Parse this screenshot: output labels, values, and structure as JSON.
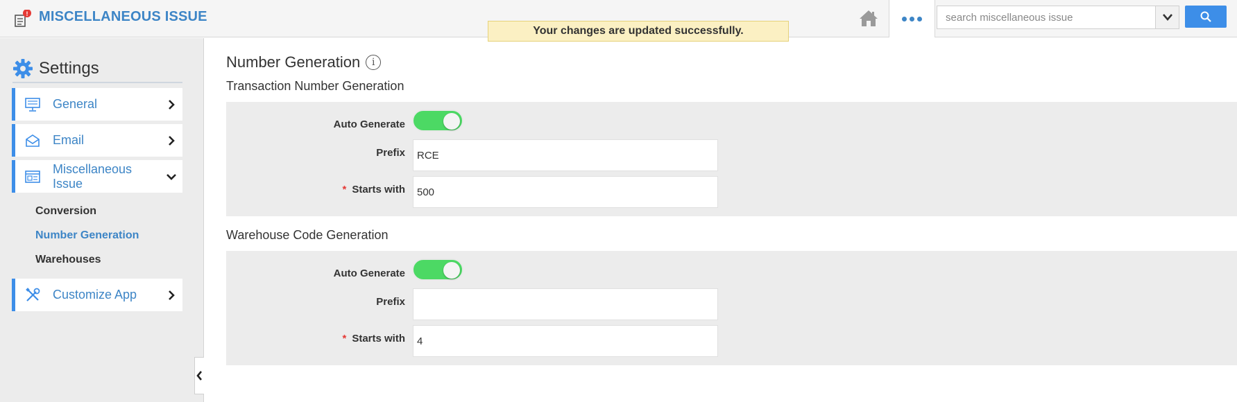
{
  "app": {
    "title": "MISCELLANEOUS ISSUE",
    "notification_count": "!"
  },
  "toast": {
    "message": "Your changes are updated successfully."
  },
  "header": {
    "home_icon": "home-icon",
    "more_icon": "ellipsis-icon",
    "search": {
      "placeholder": "search miscellaneous issue",
      "value": ""
    },
    "search_button_icon": "search-icon"
  },
  "sidebar": {
    "title": "Settings",
    "items": [
      {
        "label": "General",
        "icon": "monitor-icon",
        "chevron": "right"
      },
      {
        "label": "Email",
        "icon": "envelope-icon",
        "chevron": "right"
      },
      {
        "label": "Miscellaneous Issue",
        "icon": "document-icon",
        "chevron": "down"
      },
      {
        "label": "Customize App",
        "icon": "tools-icon",
        "chevron": "right"
      }
    ],
    "subitems": [
      {
        "label": "Conversion",
        "active": false
      },
      {
        "label": "Number Generation",
        "active": true
      },
      {
        "label": "Warehouses",
        "active": false
      }
    ]
  },
  "main": {
    "title": "Number Generation",
    "info_symbol": "i",
    "transaction": {
      "title": "Transaction Number Generation",
      "auto_generate_label": "Auto Generate",
      "auto_generate": true,
      "prefix_label": "Prefix",
      "prefix_value": "RCE",
      "starts_label": "Starts with",
      "starts_value": "500",
      "required_mark": "*"
    },
    "warehouse": {
      "title": "Warehouse Code Generation",
      "auto_generate_label": "Auto Generate",
      "auto_generate": true,
      "prefix_label": "Prefix",
      "prefix_value": "",
      "starts_label": "Starts with",
      "starts_value": "4",
      "required_mark": "*"
    }
  },
  "colors": {
    "accent": "#3d85c6",
    "toggle_on": "#4cd964",
    "toast_bg": "#fbf0c3",
    "required": "#e53935"
  }
}
